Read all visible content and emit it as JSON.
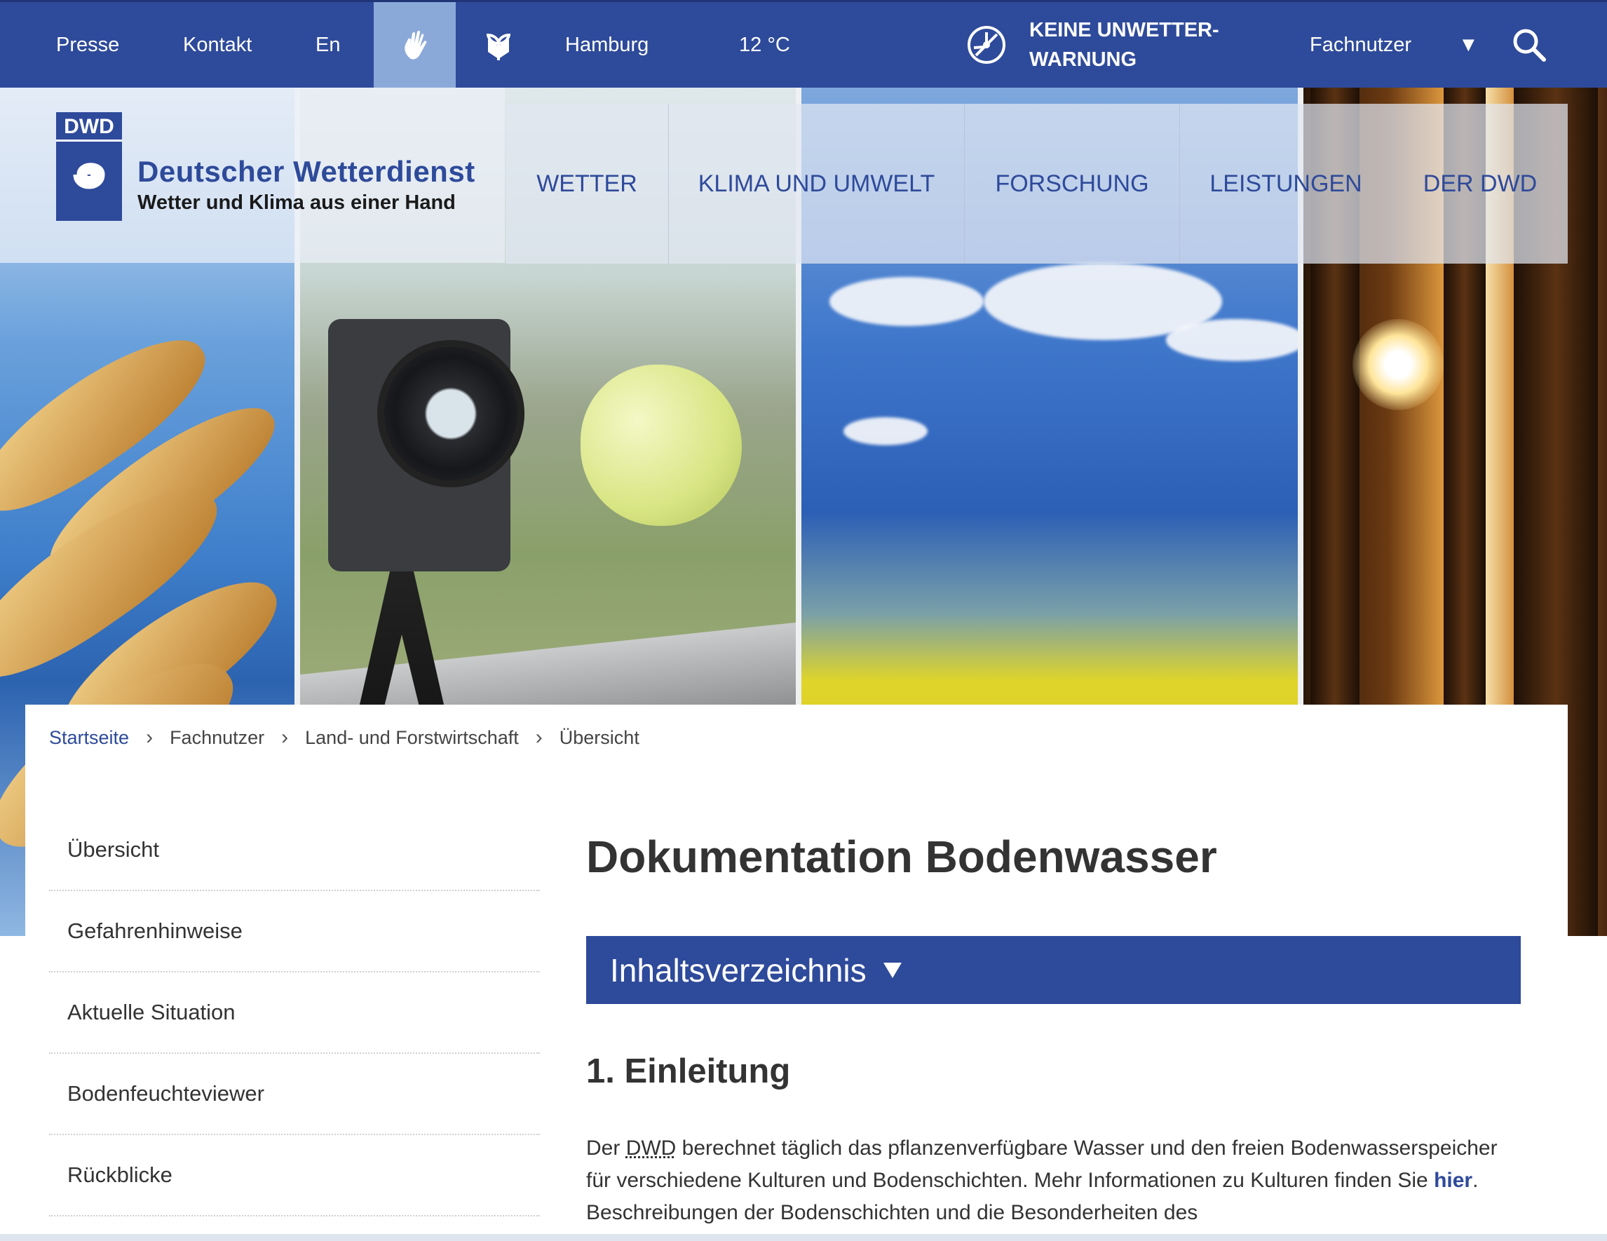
{
  "topbar": {
    "presse": "Presse",
    "kontakt": "Kontakt",
    "lang": "En",
    "city": "Hamburg",
    "temperature": "12 °C",
    "warning_line1": "KEINE UNWETTER-",
    "warning_line2": "WARNUNG",
    "user_group": "Fachnutzer",
    "caret": "▼",
    "icons": [
      "hand-sign-language-icon",
      "easy-read-icon",
      "no-warning-icon",
      "search-icon"
    ]
  },
  "logo": {
    "mark": "DWD",
    "name": "Deutscher Wetterdienst",
    "slogan": "Wetter und Klima aus einer Hand"
  },
  "mainnav": {
    "items": [
      {
        "label": "WETTER"
      },
      {
        "label": "KLIMA UND UMWELT"
      },
      {
        "label": "FORSCHUNG"
      },
      {
        "label": "LEISTUNGEN"
      },
      {
        "label": "DER DWD"
      }
    ]
  },
  "breadcrumb": {
    "items": [
      "Startseite",
      "Fachnutzer",
      "Land- und Forstwirtschaft",
      "Übersicht"
    ],
    "separator": "›"
  },
  "sidebar": {
    "items": [
      {
        "label": "Übersicht"
      },
      {
        "label": "Gefahrenhinweise"
      },
      {
        "label": "Aktuelle Situation"
      },
      {
        "label": "Bodenfeuchteviewer"
      },
      {
        "label": "Rückblicke"
      }
    ]
  },
  "main": {
    "title": "Dokumentation Bodenwasser",
    "toc_label": "Inhaltsverzeichnis",
    "section_heading": "1. Einleitung",
    "paragraph": {
      "part1": "Der ",
      "abbr": "DWD",
      "part2": " berechnet täglich das pflanzenverfügbare Wasser und den freien Bodenwasserspeicher für verschiedene Kulturen und Bodenschichten. Mehr Informationen zu Kulturen finden Sie ",
      "link": "hier",
      "part3": ". Beschreibungen der Bodenschichten und die Besonderheiten des"
    }
  },
  "colors": {
    "brand_blue": "#2e4a9a",
    "active_tab": "#8ba9d8"
  }
}
